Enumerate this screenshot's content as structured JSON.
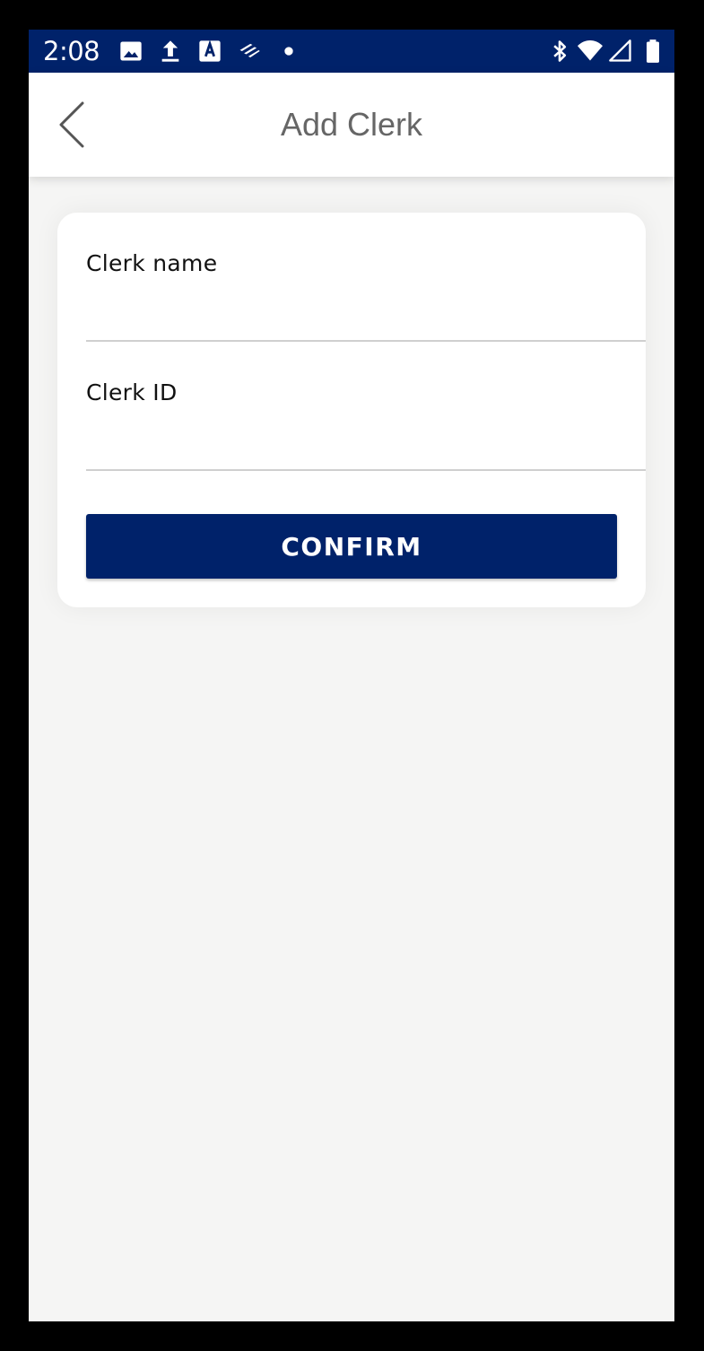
{
  "status_bar": {
    "time": "2:08",
    "left_icons": [
      "image-icon",
      "upload-icon",
      "translate-icon",
      "bank-logo-icon",
      "dot-icon"
    ],
    "right_icons": [
      "bluetooth-icon",
      "wifi-icon",
      "signal-icon",
      "battery-icon"
    ],
    "background": "#00226a"
  },
  "header": {
    "title": "Add Clerk",
    "back_icon": "chevron-left-icon"
  },
  "form": {
    "clerk_name": {
      "label": "Clerk name",
      "value": ""
    },
    "clerk_id": {
      "label": "Clerk ID",
      "value": ""
    },
    "confirm_label": "CONFIRM"
  },
  "colors": {
    "primary": "#00226a",
    "page_background": "#f5f5f4",
    "title_text": "#666666"
  }
}
